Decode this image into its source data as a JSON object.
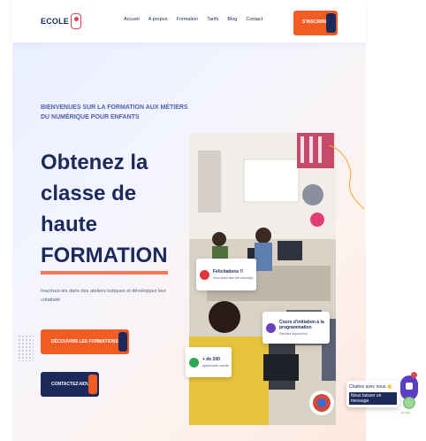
{
  "header": {
    "logo_text": "ECOLE",
    "nav": [
      "Accueil",
      "A propos",
      "Formation",
      "Tarifs",
      "Blog",
      "Contact"
    ],
    "cta_label": "S'INSCRIRE"
  },
  "hero": {
    "welcome": "BIENVENUES SUR LA FORMATION AUX MÉTIERS DU NUMÉRIQUE POUR ENFANTS",
    "title_line1": "Obtenez la",
    "title_line2": "classe de haute",
    "title_line3": "FORMATION",
    "description": "Inscrivez-les dans des ateliers ludiques et développez leur créativité",
    "primary_button": "DÉCOUVRIR LES FORMATIONS",
    "secondary_button": "CONTACTEZ-NOUS"
  },
  "cards": [
    {
      "title": "Félicitations !!",
      "subtitle": "Vous avez bien été inscrit(e)",
      "icon": "trophy-icon",
      "color": "#e0363d"
    },
    {
      "title": "Cours d'initiation à la programmation",
      "subtitle": "Débutez aujourd'hui",
      "icon": "code-icon",
      "color": "#6a3fc2"
    },
    {
      "title": "+ de 200",
      "subtitle": "apprenants inscrits",
      "icon": "users-icon",
      "color": "#2eaa52"
    }
  ],
  "chat": {
    "greeting": "Chattez avec nous 👋",
    "action": "Nous laisser un message",
    "status": "En ligne"
  },
  "colors": {
    "navy": "#1b2a5a",
    "orange": "#f25b22",
    "accent_blue": "#4f5fb0",
    "underline": "#f7795b"
  }
}
